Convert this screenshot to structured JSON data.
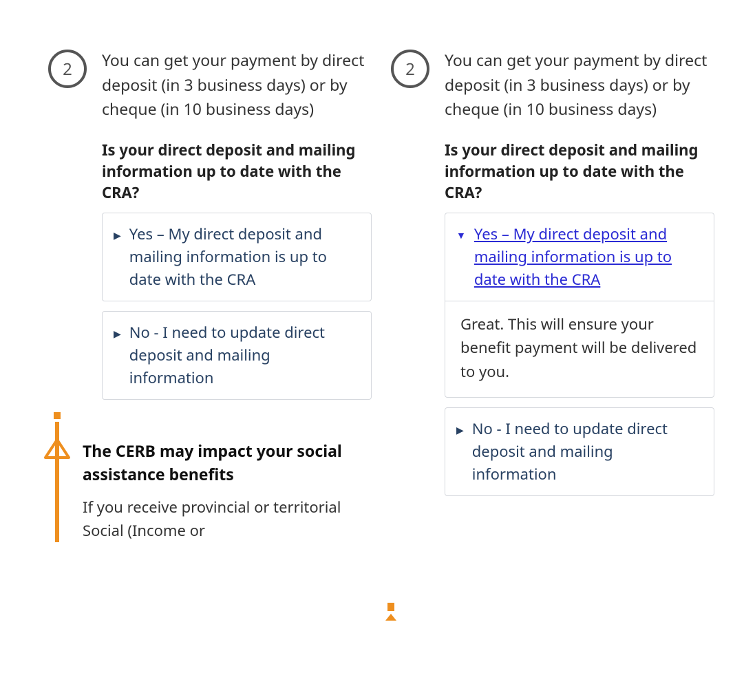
{
  "left": {
    "step_number": "2",
    "step_text": "You can get your payment by direct deposit (in 3 business days) or by cheque (in 10 business days)",
    "question": "Is your direct deposit and mailing information up to date with the CRA?",
    "option_yes": "Yes – My direct deposit and mailing information is up to date with the CRA",
    "option_no": "No - I need to update direct deposit and mailing information",
    "warn_title": "The CERB may impact your social assistance benefits",
    "warn_text": "If you receive provincial or territorial Social (Income or"
  },
  "right": {
    "step_number": "2",
    "step_text": "You can get your payment by direct deposit (in 3 business days) or by cheque (in 10 business days)",
    "question": "Is your direct deposit and mailing information up to date with the CRA?",
    "option_yes": "Yes – My direct deposit and mailing information is up to date with the CRA",
    "yes_body": "Great. This will ensure your benefit payment will be delivered to you.",
    "option_no": "No - I need to update direct deposit and mailing information"
  }
}
